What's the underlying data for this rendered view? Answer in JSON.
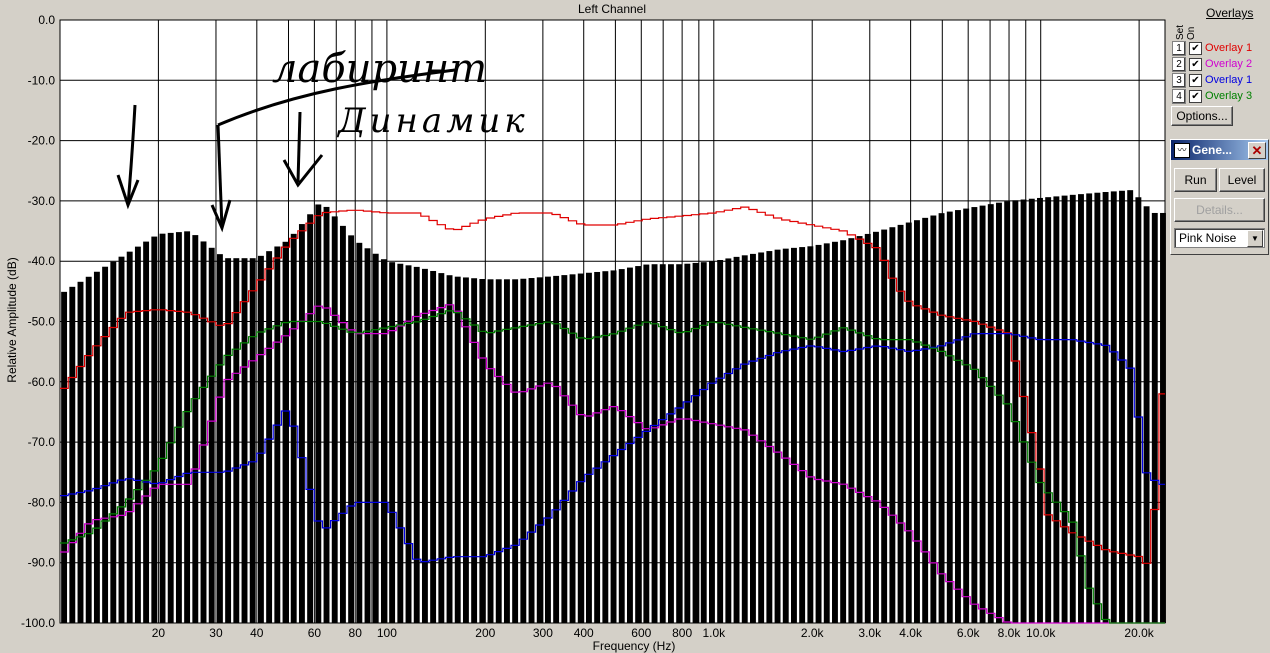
{
  "chart_data": {
    "type": "bar",
    "title": "Left Channel",
    "xlabel": "Frequency (Hz)",
    "ylabel": "Relative Amplitude (dB)",
    "xscale": "log",
    "xlim": [
      10,
      24000
    ],
    "ylim": [
      -100,
      0
    ],
    "grid": true,
    "y_ticks": [
      "0.0",
      "-10.0",
      "-20.0",
      "-30.0",
      "-40.0",
      "-50.0",
      "-60.0",
      "-70.0",
      "-80.0",
      "-90.0",
      "-100.0"
    ],
    "x_ticks": [
      {
        "v": 20,
        "t": "20"
      },
      {
        "v": 30,
        "t": "30"
      },
      {
        "v": 40,
        "t": "40"
      },
      {
        "v": 60,
        "t": "60"
      },
      {
        "v": 80,
        "t": "80"
      },
      {
        "v": 100,
        "t": "100"
      },
      {
        "v": 200,
        "t": "200"
      },
      {
        "v": 300,
        "t": "300"
      },
      {
        "v": 400,
        "t": "400"
      },
      {
        "v": 600,
        "t": "600"
      },
      {
        "v": 800,
        "t": "800"
      },
      {
        "v": 1000,
        "t": "1.0k"
      },
      {
        "v": 2000,
        "t": "2.0k"
      },
      {
        "v": 3000,
        "t": "3.0k"
      },
      {
        "v": 4000,
        "t": "4.0k"
      },
      {
        "v": 6000,
        "t": "6.0k"
      },
      {
        "v": 8000,
        "t": "8.0k"
      },
      {
        "v": 10000,
        "t": "10.0k"
      },
      {
        "v": 20000,
        "t": "20.0k"
      }
    ],
    "bars": {
      "color": "#000000",
      "bins_per_octave": 12,
      "points": [
        [
          10,
          -45.5
        ],
        [
          20,
          -35.5
        ],
        [
          25,
          -35
        ],
        [
          32,
          -39.5
        ],
        [
          40,
          -39.5
        ],
        [
          50,
          -36.5
        ],
        [
          63,
          -30
        ],
        [
          80,
          -36.5
        ],
        [
          100,
          -40
        ],
        [
          125,
          -41
        ],
        [
          160,
          -42.5
        ],
        [
          200,
          -43
        ],
        [
          250,
          -43
        ],
        [
          320,
          -42.5
        ],
        [
          400,
          -42
        ],
        [
          500,
          -41.5
        ],
        [
          630,
          -40.5
        ],
        [
          800,
          -40.5
        ],
        [
          1000,
          -40
        ],
        [
          1250,
          -39
        ],
        [
          1600,
          -38
        ],
        [
          2000,
          -37.5
        ],
        [
          2500,
          -36.5
        ],
        [
          3200,
          -35
        ],
        [
          4000,
          -33.5
        ],
        [
          5000,
          -32
        ],
        [
          6300,
          -31
        ],
        [
          8000,
          -30
        ],
        [
          10000,
          -29.5
        ],
        [
          12500,
          -29
        ],
        [
          16000,
          -28.5
        ],
        [
          19000,
          -28.2
        ],
        [
          22000,
          -32
        ]
      ]
    },
    "series": [
      {
        "name": "Overlay 1",
        "color": "#e00000",
        "points": [
          [
            10,
            -62
          ],
          [
            12.5,
            -55
          ],
          [
            16,
            -48.5
          ],
          [
            20,
            -48
          ],
          [
            25,
            -48.5
          ],
          [
            32,
            -51
          ],
          [
            40,
            -44
          ],
          [
            50,
            -37
          ],
          [
            63,
            -32
          ],
          [
            80,
            -31.5
          ],
          [
            100,
            -32
          ],
          [
            125,
            -32
          ],
          [
            160,
            -35
          ],
          [
            200,
            -33
          ],
          [
            250,
            -32
          ],
          [
            320,
            -32
          ],
          [
            400,
            -34
          ],
          [
            500,
            -34
          ],
          [
            630,
            -33
          ],
          [
            800,
            -32.5
          ],
          [
            1000,
            -32
          ],
          [
            1250,
            -31
          ],
          [
            1600,
            -33
          ],
          [
            2000,
            -34
          ],
          [
            2500,
            -35
          ],
          [
            3200,
            -38
          ],
          [
            3600,
            -44
          ],
          [
            4000,
            -47
          ],
          [
            5000,
            -49
          ],
          [
            6300,
            -50
          ],
          [
            8000,
            -52
          ],
          [
            9000,
            -64
          ],
          [
            10000,
            -75
          ],
          [
            10500,
            -82
          ],
          [
            12500,
            -85
          ],
          [
            16000,
            -88
          ],
          [
            20000,
            -89
          ],
          [
            22000,
            -91
          ],
          [
            23000,
            -62
          ]
        ]
      },
      {
        "name": "Overlay 2",
        "color": "#d000d0",
        "points": [
          [
            10,
            -89
          ],
          [
            12.5,
            -83
          ],
          [
            16,
            -82
          ],
          [
            20,
            -77
          ],
          [
            25,
            -77
          ],
          [
            32,
            -60
          ],
          [
            40,
            -56
          ],
          [
            50,
            -52
          ],
          [
            63,
            -47
          ],
          [
            80,
            -52
          ],
          [
            100,
            -52
          ],
          [
            125,
            -49
          ],
          [
            160,
            -47
          ],
          [
            200,
            -57
          ],
          [
            250,
            -62
          ],
          [
            320,
            -60
          ],
          [
            400,
            -66
          ],
          [
            500,
            -64
          ],
          [
            630,
            -68
          ],
          [
            800,
            -66
          ],
          [
            1000,
            -67
          ],
          [
            1250,
            -68
          ],
          [
            1600,
            -72
          ],
          [
            2000,
            -76
          ],
          [
            2500,
            -77
          ],
          [
            3200,
            -80
          ],
          [
            4000,
            -85
          ],
          [
            5000,
            -92
          ],
          [
            6300,
            -97
          ],
          [
            8000,
            -100
          ],
          [
            12500,
            -100
          ],
          [
            23000,
            -100
          ]
        ]
      },
      {
        "name": "Overlay 1",
        "color": "#0000e0",
        "points": [
          [
            10,
            -79
          ],
          [
            12.5,
            -78
          ],
          [
            16,
            -76
          ],
          [
            20,
            -77
          ],
          [
            25,
            -75
          ],
          [
            32,
            -75
          ],
          [
            40,
            -73
          ],
          [
            50,
            -64
          ],
          [
            63,
            -85
          ],
          [
            80,
            -80
          ],
          [
            100,
            -80
          ],
          [
            125,
            -90
          ],
          [
            160,
            -89
          ],
          [
            200,
            -89
          ],
          [
            250,
            -87
          ],
          [
            320,
            -82
          ],
          [
            400,
            -76
          ],
          [
            500,
            -72
          ],
          [
            630,
            -68
          ],
          [
            800,
            -64
          ],
          [
            1000,
            -60
          ],
          [
            1250,
            -57
          ],
          [
            1600,
            -55
          ],
          [
            2000,
            -54
          ],
          [
            2500,
            -55
          ],
          [
            3200,
            -54
          ],
          [
            4000,
            -55
          ],
          [
            5000,
            -54
          ],
          [
            6300,
            -52
          ],
          [
            8000,
            -52
          ],
          [
            10000,
            -53
          ],
          [
            12500,
            -53
          ],
          [
            16000,
            -54
          ],
          [
            19000,
            -58
          ],
          [
            21000,
            -75
          ],
          [
            23000,
            -77
          ]
        ]
      },
      {
        "name": "Overlay 3",
        "color": "#008000",
        "points": [
          [
            10,
            -87
          ],
          [
            12.5,
            -85
          ],
          [
            16,
            -80
          ],
          [
            20,
            -74
          ],
          [
            25,
            -64
          ],
          [
            32,
            -56
          ],
          [
            40,
            -52
          ],
          [
            50,
            -50
          ],
          [
            63,
            -50
          ],
          [
            80,
            -52
          ],
          [
            100,
            -51
          ],
          [
            125,
            -50
          ],
          [
            160,
            -48
          ],
          [
            200,
            -52
          ],
          [
            250,
            -51
          ],
          [
            320,
            -50
          ],
          [
            400,
            -53
          ],
          [
            500,
            -52
          ],
          [
            630,
            -50
          ],
          [
            800,
            -52
          ],
          [
            1000,
            -50
          ],
          [
            1250,
            -51
          ],
          [
            1600,
            -52
          ],
          [
            2000,
            -53
          ],
          [
            2500,
            -51
          ],
          [
            3200,
            -53
          ],
          [
            4000,
            -53
          ],
          [
            5000,
            -55
          ],
          [
            6300,
            -58
          ],
          [
            8000,
            -64
          ],
          [
            10000,
            -77
          ],
          [
            12500,
            -83
          ],
          [
            14000,
            -94
          ],
          [
            16000,
            -100
          ],
          [
            23000,
            -100
          ]
        ]
      }
    ]
  },
  "annotations": {
    "labyrinth": "лабиринт",
    "driver": "Динамик"
  },
  "overlays": {
    "title": "Overlays",
    "col_set": "Set",
    "col_on": "On",
    "items": [
      {
        "num": "1",
        "label": "Overlay 1",
        "color": "#e00000"
      },
      {
        "num": "2",
        "label": "Overlay 2",
        "color": "#d000d0"
      },
      {
        "num": "3",
        "label": "Overlay 1",
        "color": "#0000e0"
      },
      {
        "num": "4",
        "label": "Overlay 3",
        "color": "#008000"
      }
    ],
    "checked": "✔",
    "options_label": "Options..."
  },
  "generator": {
    "title": "Gene...",
    "icon": "waveform-icon",
    "run_label": "Run",
    "level_label": "Level",
    "details_label": "Details...",
    "signal": "Pink Noise",
    "close_glyph": "✕",
    "arrow_glyph": "▼",
    "icon_glyph": "〰"
  }
}
